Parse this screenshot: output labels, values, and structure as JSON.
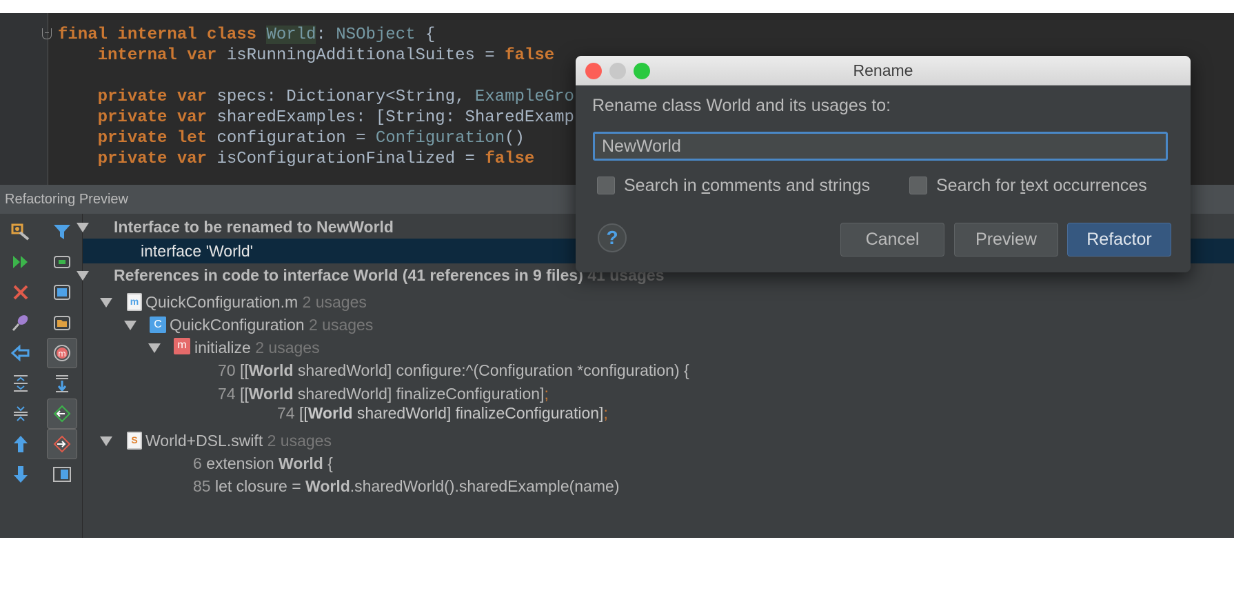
{
  "editor": {
    "lines": [
      [
        {
          "t": "final internal class ",
          "c": "kw"
        },
        {
          "t": "World",
          "c": "ty hl"
        },
        {
          "t": ": ",
          "c": "pl"
        },
        {
          "t": "NSObject",
          "c": "ty"
        },
        {
          "t": " {",
          "c": "pl"
        }
      ],
      [
        {
          "t": "    internal var ",
          "c": "kw"
        },
        {
          "t": "isRunningAdditionalSuites = ",
          "c": "pl"
        },
        {
          "t": "false",
          "c": "kw"
        }
      ],
      [],
      [
        {
          "t": "    private var ",
          "c": "kw"
        },
        {
          "t": "specs: ",
          "c": "pl"
        },
        {
          "t": "Dictionary",
          "c": "pl"
        },
        {
          "t": "<String, ",
          "c": "pl"
        },
        {
          "t": "ExampleGroup",
          "c": "ty"
        }
      ],
      [
        {
          "t": "    private var ",
          "c": "kw"
        },
        {
          "t": "sharedExamples: [String: SharedExample",
          "c": "pl"
        }
      ],
      [
        {
          "t": "    private let ",
          "c": "kw"
        },
        {
          "t": "configuration = ",
          "c": "pl"
        },
        {
          "t": "Configuration",
          "c": "ty"
        },
        {
          "t": "()",
          "c": "pl"
        }
      ],
      [
        {
          "t": "    private var ",
          "c": "kw"
        },
        {
          "t": "isConfigurationFinalized = ",
          "c": "pl"
        },
        {
          "t": "false",
          "c": "kw"
        }
      ]
    ]
  },
  "panel": {
    "title": "Refactoring Preview",
    "tree": {
      "group1": {
        "label": "Interface to be renamed to NewWorld"
      },
      "selected_item": {
        "label": "interface 'World'"
      },
      "group2": {
        "label": "References in code to interface World (41 references in 9 files)",
        "usages": "41 usages"
      },
      "file1": {
        "name": "QuickConfiguration.m",
        "usages": "2 usages",
        "icon_letter": "m"
      },
      "class1": {
        "name": "QuickConfiguration",
        "usages": "2 usages",
        "icon_letter": "C"
      },
      "method1": {
        "name": "initialize",
        "usages": "2 usages",
        "icon_letter": "m"
      },
      "ref1": {
        "line": "70",
        "pre": "[[",
        "bold": "World",
        "post": " sharedWorld] configure:^(Configuration *configuration) {"
      },
      "ref2": {
        "line": "74",
        "pre": "[[",
        "bold": "World",
        "post": " sharedWorld] finalizeConfiguration]",
        "semi": ";"
      },
      "ref2_drag": {
        "line": "74",
        "pre": "[[",
        "bold": "World",
        "post": " sharedWorld] finalizeConfiguration]",
        "semi": ";"
      },
      "file2": {
        "name": "World+DSL.swift",
        "usages": "2 usages",
        "icon_letter": "S"
      },
      "ref3": {
        "line": "6",
        "pre": "extension ",
        "bold": "World",
        "post": " {"
      },
      "ref4": {
        "line": "85",
        "pre": "let closure = ",
        "bold": "World",
        "post": ".sharedWorld().sharedExample(name)"
      }
    }
  },
  "dialog": {
    "title": "Rename",
    "prompt": "Rename class World and its usages to:",
    "input_value": "NewWorld",
    "opt1": {
      "pre": "Search in ",
      "u": "c",
      "post": "omments and strings",
      "checked": false
    },
    "opt2": {
      "pre": "Search for ",
      "u": "t",
      "post": "ext occurrences",
      "checked": false
    },
    "help_label": "?",
    "cancel_label": "Cancel",
    "preview_label": "Preview",
    "refactor_label": "Refactor"
  },
  "colors": {
    "keyword": "#cc7832",
    "type": "#769aa5",
    "selection": "#0d293e",
    "accent": "#4a88c7",
    "traffic_close": "#fc5f57",
    "traffic_min": "#c8c8c8",
    "traffic_max": "#2ac940"
  },
  "icons": {
    "col1": [
      "settings-wrench-icon",
      "rerun-icon",
      "close-icon",
      "pin-icon",
      "back-arrow-icon",
      "expand-all-icon",
      "collapse-all-icon",
      "previous-occurrence-icon",
      "next-occurrence-icon"
    ],
    "col2": [
      "filter-icon",
      "group-by-module-icon",
      "group-by-package-icon",
      "group-by-directory-icon",
      "show-method-icon",
      "autoscroll-to-source-icon",
      "read-access-icon",
      "write-access-icon",
      "preview-icon"
    ]
  }
}
